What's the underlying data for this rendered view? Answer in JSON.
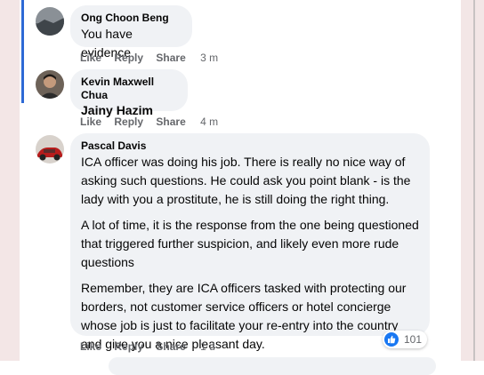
{
  "comments": [
    {
      "author": "Ong Choon Beng",
      "text": "You have evidence",
      "actions": {
        "like": "Like",
        "reply": "Reply",
        "share": "Share",
        "time": "3 m"
      }
    },
    {
      "author": "Kevin Maxwell Chua",
      "text": "Jainy Hazim",
      "actions": {
        "like": "Like",
        "reply": "Reply",
        "share": "Share",
        "time": "4 m"
      }
    },
    {
      "author": "Pascal Davis",
      "paragraphs": [
        "ICA officer was doing his job. There is really no nice way of asking such questions. He could ask you point blank - is the lady with you a prostitute, he is still doing the right thing.",
        "A lot of time, it is the response from the one being questioned that triggered further suspicion, and likely even more rude questions",
        "Remember, they are ICA officers tasked with protecting our borders, not customer service officers or hotel concierge whose job is just to facilitate your re-entry into the country and give you a nice pleasant day."
      ],
      "actions": {
        "like": "Like",
        "reply": "Reply",
        "share": "Share",
        "time": "1 d"
      },
      "reaction_count": "101",
      "reaction_icon": "like-icon"
    }
  ],
  "colors": {
    "bubble": "#f0f2f5",
    "thread_line": "#2d6ad6",
    "action_text": "#65676b",
    "like_blue": "#1877f2"
  }
}
